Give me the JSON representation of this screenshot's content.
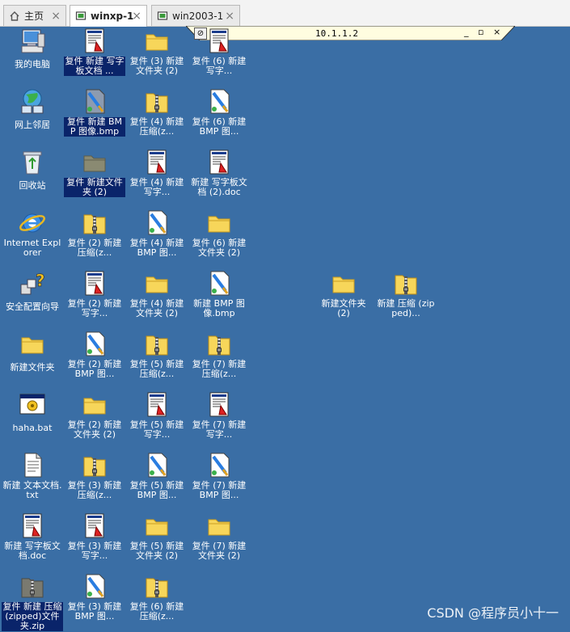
{
  "tabs": [
    {
      "label": "主页",
      "icon": "home-icon",
      "active": false
    },
    {
      "label": "winxp-1",
      "icon": "vm-icon",
      "active": true
    },
    {
      "label": "win2003-1",
      "icon": "vm-icon",
      "active": false
    }
  ],
  "remote_bar": {
    "host": "10.1.1.2",
    "pin_icon": "pin-icon",
    "controls": "_ ▫ ×"
  },
  "desktop_icons": [
    {
      "label": "我的电脑",
      "kind": "mycomputer",
      "col": 0,
      "row": 0
    },
    {
      "label": "网上邻居",
      "kind": "network",
      "col": 0,
      "row": 1
    },
    {
      "label": "回收站",
      "kind": "recycle",
      "col": 0,
      "row": 2
    },
    {
      "label": "Internet Explorer",
      "kind": "ie",
      "col": 0,
      "row": 3
    },
    {
      "label": "安全配置向导",
      "kind": "wizard",
      "col": 0,
      "row": 4
    },
    {
      "label": "新建文件夹",
      "kind": "folder",
      "col": 0,
      "row": 5
    },
    {
      "label": "haha.bat",
      "kind": "bat",
      "col": 0,
      "row": 6
    },
    {
      "label": "新建 文本文档.txt",
      "kind": "txt",
      "col": 0,
      "row": 7
    },
    {
      "label": "新建 写字板文档.doc",
      "kind": "doc",
      "col": 0,
      "row": 8
    },
    {
      "label": "复件 新建 压缩(zipped)文件夹.zip",
      "kind": "zipdark",
      "col": 0,
      "row": 9,
      "selected": true
    },
    {
      "label": "复件 新建 写字板文档 ...",
      "kind": "doc",
      "col": 1,
      "row": 0,
      "selected": true
    },
    {
      "label": "复件 新建 BMP 图像.bmp",
      "kind": "bmpdark",
      "col": 1,
      "row": 1,
      "selected": true
    },
    {
      "label": "复件 新建文件夹 (2)",
      "kind": "folderdark",
      "col": 1,
      "row": 2,
      "selected": true
    },
    {
      "label": "复件 (2) 新建 压缩(z...",
      "kind": "zip",
      "col": 1,
      "row": 3
    },
    {
      "label": "复件 (2) 新建 写字...",
      "kind": "doc",
      "col": 1,
      "row": 4
    },
    {
      "label": "复件 (2) 新建 BMP 图...",
      "kind": "bmp",
      "col": 1,
      "row": 5
    },
    {
      "label": "复件 (2) 新建文件夹 (2)",
      "kind": "folder",
      "col": 1,
      "row": 6
    },
    {
      "label": "复件 (3) 新建 压缩(z...",
      "kind": "zip",
      "col": 1,
      "row": 7
    },
    {
      "label": "复件 (3) 新建 写字...",
      "kind": "doc",
      "col": 1,
      "row": 8
    },
    {
      "label": "复件 (3) 新建 BMP 图...",
      "kind": "bmp",
      "col": 1,
      "row": 9
    },
    {
      "label": "复件 (3) 新建文件夹 (2)",
      "kind": "folder",
      "col": 2,
      "row": 0
    },
    {
      "label": "复件 (4) 新建 压缩(z...",
      "kind": "zip",
      "col": 2,
      "row": 1
    },
    {
      "label": "复件 (4) 新建 写字...",
      "kind": "doc",
      "col": 2,
      "row": 2
    },
    {
      "label": "复件 (4) 新建 BMP 图...",
      "kind": "bmp",
      "col": 2,
      "row": 3
    },
    {
      "label": "复件 (4) 新建文件夹 (2)",
      "kind": "folder",
      "col": 2,
      "row": 4
    },
    {
      "label": "复件 (5) 新建 压缩(z...",
      "kind": "zip",
      "col": 2,
      "row": 5
    },
    {
      "label": "复件 (5) 新建 写字...",
      "kind": "doc",
      "col": 2,
      "row": 6
    },
    {
      "label": "复件 (5) 新建 BMP 图...",
      "kind": "bmp",
      "col": 2,
      "row": 7
    },
    {
      "label": "复件 (5) 新建文件夹 (2)",
      "kind": "folder",
      "col": 2,
      "row": 8
    },
    {
      "label": "复件 (6) 新建 压缩(z...",
      "kind": "zip",
      "col": 2,
      "row": 9
    },
    {
      "label": "复件 (6) 新建 写字...",
      "kind": "doc",
      "col": 3,
      "row": 0
    },
    {
      "label": "复件 (6) 新建 BMP 图...",
      "kind": "bmp",
      "col": 3,
      "row": 1
    },
    {
      "label": "新建 写字板文档 (2).doc",
      "kind": "doc",
      "col": 3,
      "row": 2
    },
    {
      "label": "复件 (6) 新建文件夹 (2)",
      "kind": "folder",
      "col": 3,
      "row": 3
    },
    {
      "label": "新建 BMP 图像.bmp",
      "kind": "bmp",
      "col": 3,
      "row": 4
    },
    {
      "label": "复件 (7) 新建 压缩(z...",
      "kind": "zip",
      "col": 3,
      "row": 5
    },
    {
      "label": "复件 (7) 新建 写字...",
      "kind": "doc",
      "col": 3,
      "row": 6
    },
    {
      "label": "复件 (7) 新建 BMP 图...",
      "kind": "bmp",
      "col": 3,
      "row": 7
    },
    {
      "label": "复件 (7) 新建文件夹 (2)",
      "kind": "folder",
      "col": 3,
      "row": 8
    },
    {
      "label": "新建文件夹 (2)",
      "kind": "folder",
      "col": 5,
      "row": 4
    },
    {
      "label": "新建 压缩 (zipped)...",
      "kind": "zip",
      "col": 6,
      "row": 4
    }
  ],
  "watermark": "CSDN @程序员小十一",
  "colors": {
    "desktop": "#3a6ea5",
    "selection": "#0a246a",
    "remote_bar": "#fffde0"
  }
}
